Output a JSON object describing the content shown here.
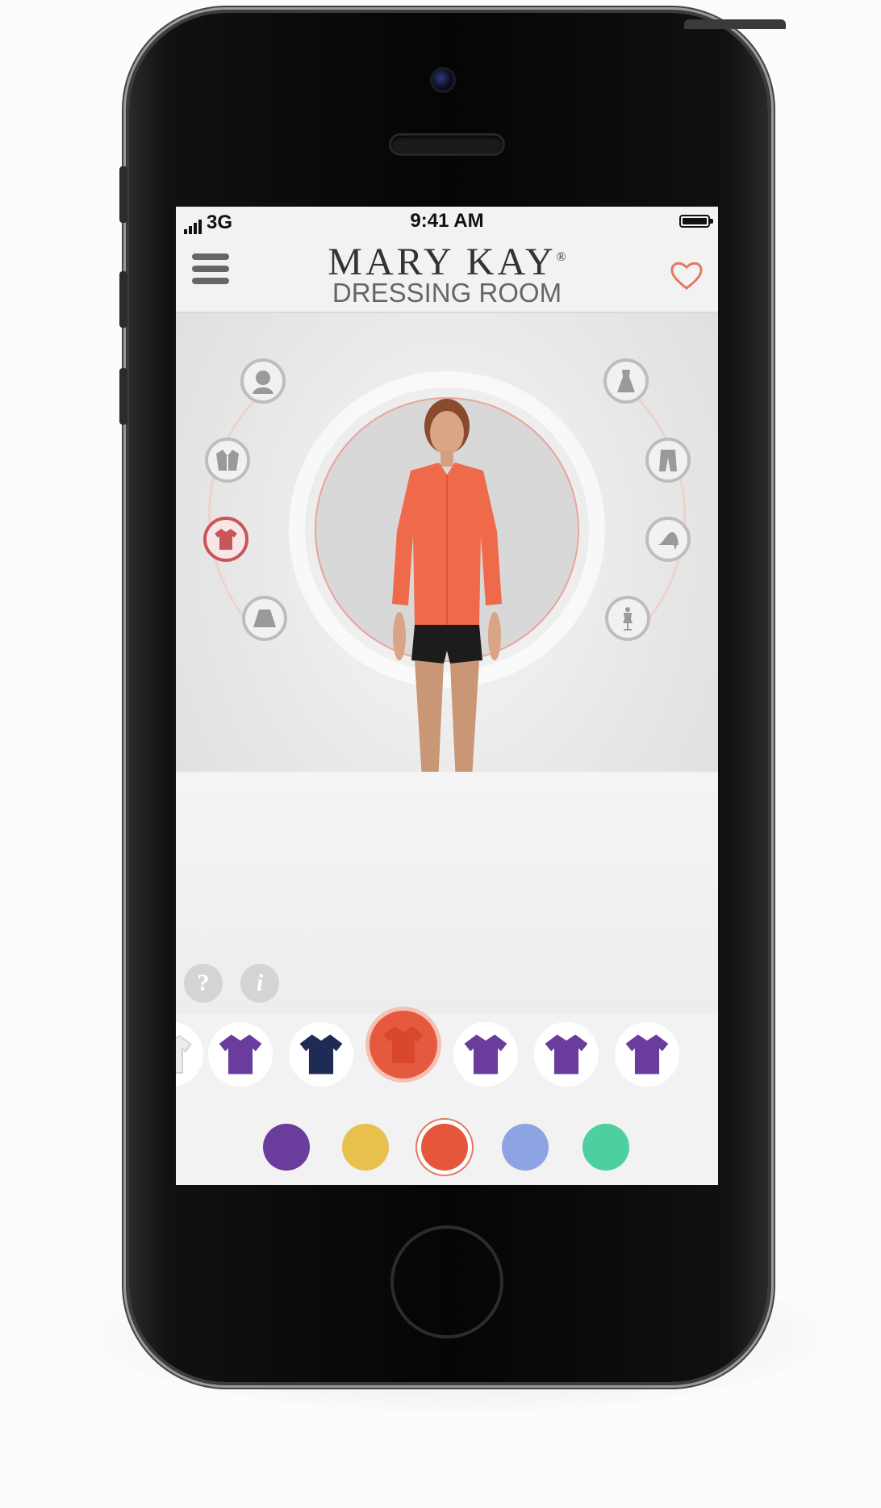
{
  "status_bar": {
    "signal": "3G",
    "time": "9:41 AM"
  },
  "header": {
    "brand": "MARY KAY",
    "brand_mark": "®",
    "subtitle": "DRESSING ROOM"
  },
  "help": {
    "question": "?",
    "info": "i"
  },
  "categories_left": [
    {
      "icon": "hair-icon",
      "active": false
    },
    {
      "icon": "jacket-icon",
      "active": false
    },
    {
      "icon": "blouse-icon",
      "active": true
    },
    {
      "icon": "skirt-icon",
      "active": false
    }
  ],
  "categories_right": [
    {
      "icon": "dress-icon",
      "active": false
    },
    {
      "icon": "pants-icon",
      "active": false
    },
    {
      "icon": "heels-icon",
      "active": false
    },
    {
      "icon": "mannequin-icon",
      "active": false
    }
  ],
  "carousel": [
    {
      "color": "#ececec",
      "selected": false
    },
    {
      "color": "#6a3c9c",
      "selected": false
    },
    {
      "color": "#1f2b55",
      "selected": false
    },
    {
      "color": "#e55a3e",
      "selected": true
    },
    {
      "color": "#6a3c9c",
      "selected": false
    },
    {
      "color": "#6a3c9c",
      "selected": false
    },
    {
      "color": "#6a3c9c",
      "selected": false
    }
  ],
  "swatches": [
    {
      "color": "#6a3c9c",
      "selected": false
    },
    {
      "color": "#e8c04e",
      "selected": false
    },
    {
      "color": "#e5563a",
      "selected": true
    },
    {
      "color": "#8ea3e2",
      "selected": false
    },
    {
      "color": "#4dcf9f",
      "selected": false
    }
  ],
  "colors": {
    "accent": "#e57762",
    "icon_gray": "#9a9a9a"
  }
}
